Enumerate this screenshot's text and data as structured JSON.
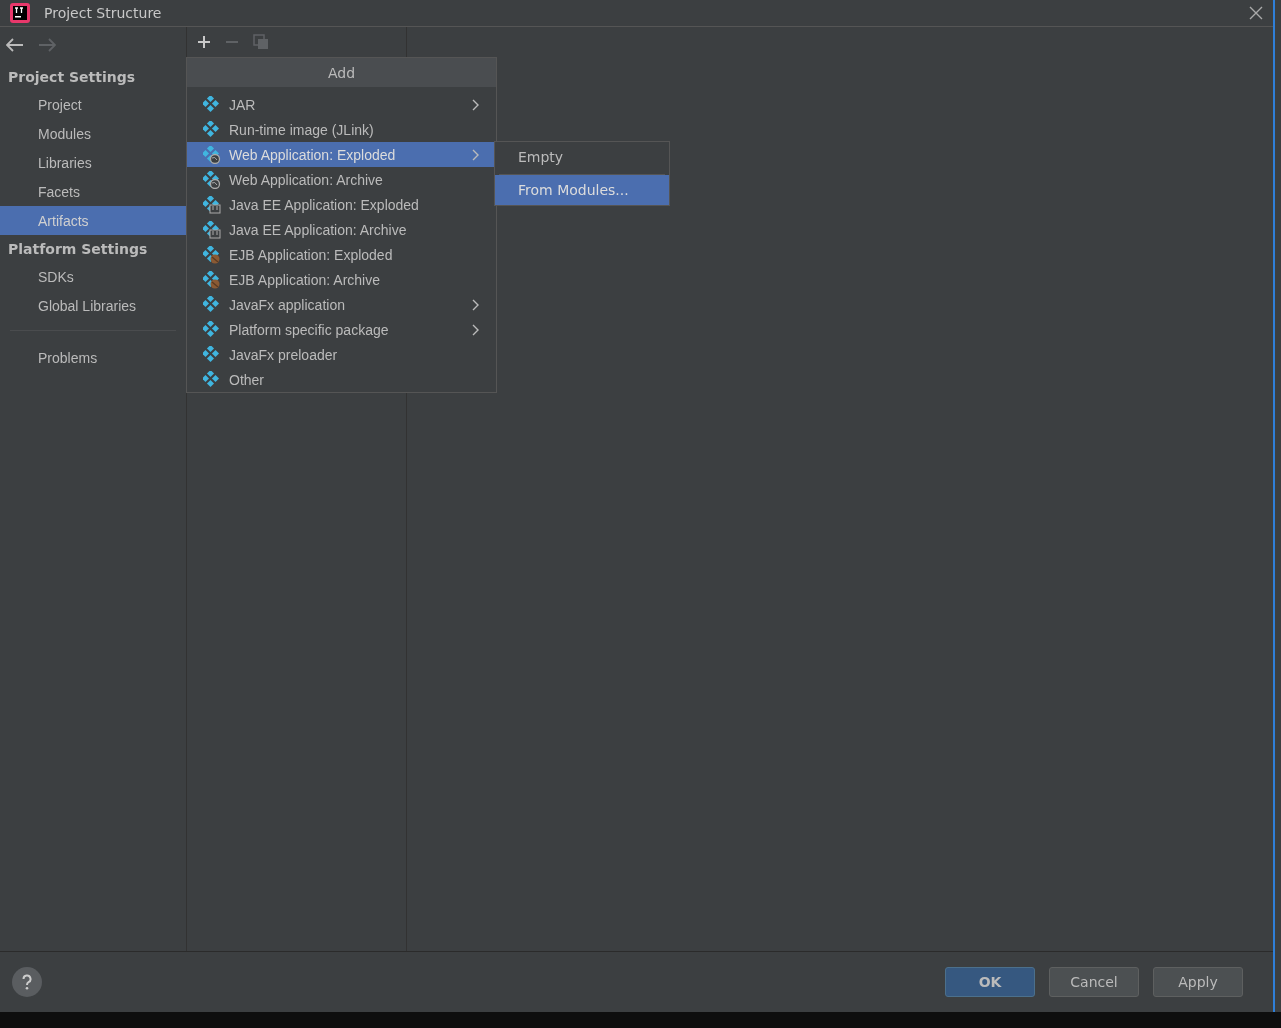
{
  "window": {
    "title": "Project Structure"
  },
  "sidebar": {
    "sections": [
      {
        "title": "Project Settings",
        "items": [
          {
            "label": "Project",
            "selected": false
          },
          {
            "label": "Modules",
            "selected": false
          },
          {
            "label": "Libraries",
            "selected": false
          },
          {
            "label": "Facets",
            "selected": false
          },
          {
            "label": "Artifacts",
            "selected": true
          }
        ]
      },
      {
        "title": "Platform Settings",
        "items": [
          {
            "label": "SDKs",
            "selected": false
          },
          {
            "label": "Global Libraries",
            "selected": false
          }
        ]
      }
    ],
    "footer_items": [
      {
        "label": "Problems",
        "selected": false
      }
    ]
  },
  "add_menu": {
    "title": "Add",
    "items": [
      {
        "label": "JAR",
        "kind": "plain",
        "submenu": true,
        "selected": false
      },
      {
        "label": "Run-time image (JLink)",
        "kind": "plain",
        "submenu": false,
        "selected": false
      },
      {
        "label": "Web Application: Exploded",
        "kind": "web",
        "submenu": true,
        "selected": true
      },
      {
        "label": "Web Application: Archive",
        "kind": "web",
        "submenu": false,
        "selected": false
      },
      {
        "label": "Java EE Application: Exploded",
        "kind": "javaee",
        "submenu": false,
        "selected": false
      },
      {
        "label": "Java EE Application: Archive",
        "kind": "javaee",
        "submenu": false,
        "selected": false
      },
      {
        "label": "EJB Application: Exploded",
        "kind": "ejb",
        "submenu": false,
        "selected": false
      },
      {
        "label": "EJB Application: Archive",
        "kind": "ejb",
        "submenu": false,
        "selected": false
      },
      {
        "label": "JavaFx application",
        "kind": "plain",
        "submenu": true,
        "selected": false
      },
      {
        "label": "Platform specific package",
        "kind": "plain",
        "submenu": true,
        "selected": false
      },
      {
        "label": "JavaFx preloader",
        "kind": "plain",
        "submenu": false,
        "selected": false
      },
      {
        "label": "Other",
        "kind": "plain",
        "submenu": false,
        "selected": false
      }
    ]
  },
  "submenu": {
    "items": [
      {
        "label": "Empty",
        "selected": false
      },
      {
        "label": "From Modules...",
        "selected": true
      }
    ]
  },
  "buttons": [
    {
      "label": "OK",
      "kind": "primary"
    },
    {
      "label": "Cancel",
      "kind": "normal"
    },
    {
      "label": "Apply",
      "kind": "normal"
    }
  ]
}
